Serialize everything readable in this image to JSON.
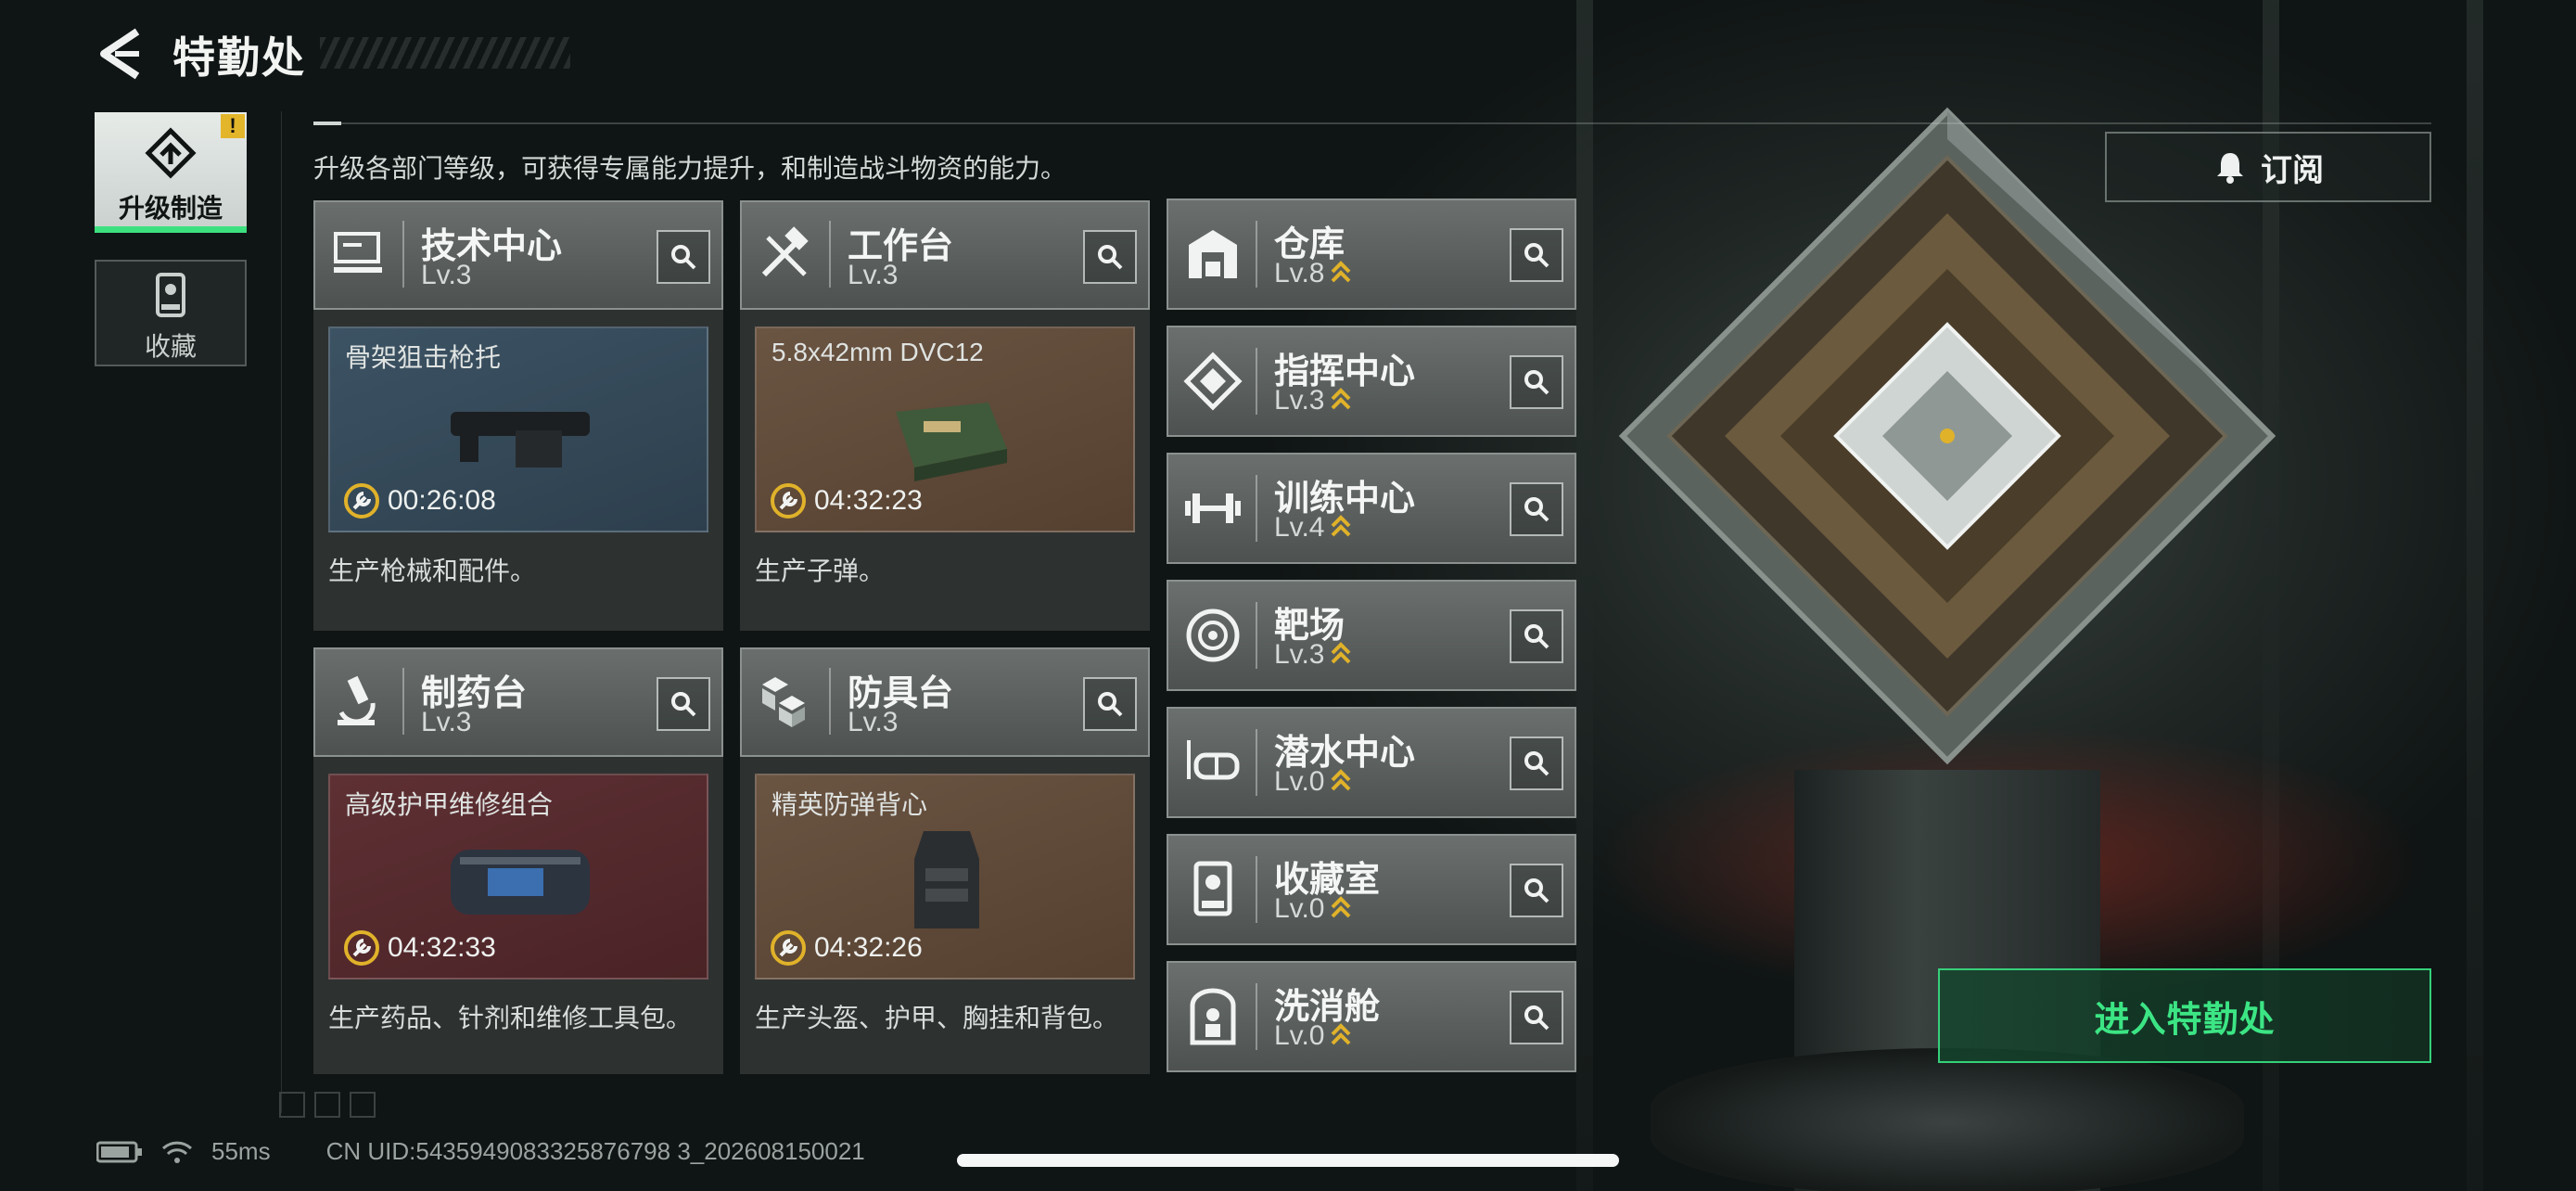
{
  "header": {
    "title": "特勤处"
  },
  "nav": {
    "upgrade": {
      "label": "升级制造",
      "alert": "!"
    },
    "favorites": {
      "label": "收藏"
    }
  },
  "subtitle": "升级各部门等级，可获得专属能力提升，和制造战斗物资的能力。",
  "subscribe": {
    "label": "订阅"
  },
  "enter_button": {
    "label": "进入特勤处"
  },
  "status": {
    "ping": "55ms",
    "uid": "CN UID:5435949083325876798 3_202608150021"
  },
  "large_cards": [
    {
      "name": "技术中心",
      "level": "Lv.3",
      "item": "骨架狙击枪托",
      "timer": "00:26:08",
      "desc": "生产枪械和配件。",
      "icon": "computer-icon",
      "body_color": "blue"
    },
    {
      "name": "工作台",
      "level": "Lv.3",
      "item": "5.8x42mm DVC12",
      "timer": "04:32:23",
      "desc": "生产子弹。",
      "icon": "tools-icon",
      "body_color": "brown"
    },
    {
      "name": "制药台",
      "level": "Lv.3",
      "item": "高级护甲维修组合",
      "timer": "04:32:33",
      "desc": "生产药品、针剂和维修工具包。",
      "icon": "microscope-icon",
      "body_color": "red"
    },
    {
      "name": "防具台",
      "level": "Lv.3",
      "item": "精英防弹背心",
      "timer": "04:32:26",
      "desc": "生产头盔、护甲、胸挂和背包。",
      "icon": "armor-boxes-icon",
      "body_color": "brown"
    }
  ],
  "facilities": [
    {
      "name": "仓库",
      "level": "Lv.8",
      "icon": "warehouse-icon"
    },
    {
      "name": "指挥中心",
      "level": "Lv.3",
      "icon": "command-icon"
    },
    {
      "name": "训练中心",
      "level": "Lv.4",
      "icon": "dumbbell-icon"
    },
    {
      "name": "靶场",
      "level": "Lv.3",
      "icon": "target-icon"
    },
    {
      "name": "潜水中心",
      "level": "Lv.0",
      "icon": "diving-mask-icon"
    },
    {
      "name": "收藏室",
      "level": "Lv.0",
      "icon": "display-case-icon"
    },
    {
      "name": "洗消舱",
      "level": "Lv.0",
      "icon": "decon-pod-icon"
    }
  ],
  "colors": {
    "accent_green": "#3de07f",
    "alert_yellow": "#e3b52a",
    "level_chevron": "#e0b22a"
  }
}
